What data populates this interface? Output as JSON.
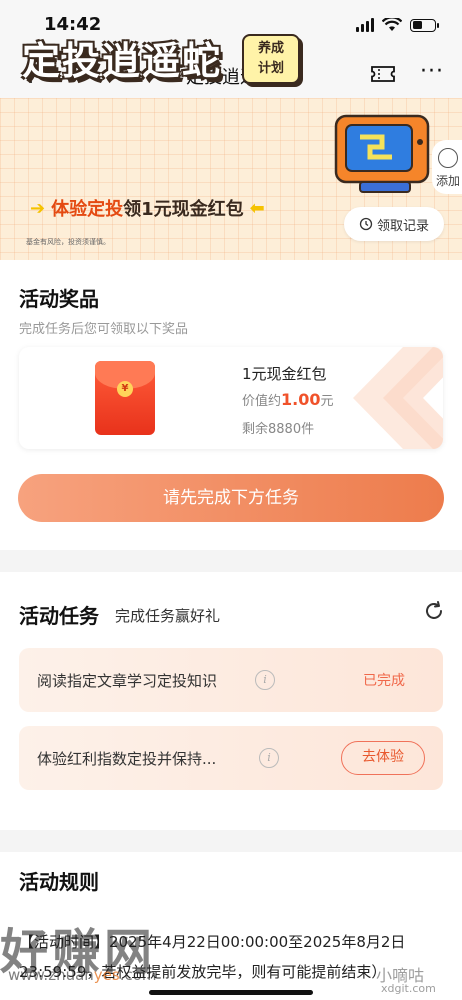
{
  "status_bar": {
    "time": "14:42"
  },
  "nav": {
    "title": "定投逍遥蛇",
    "more": "···"
  },
  "banner": {
    "title": "定投逍遥蛇",
    "badge_line1": "养成",
    "badge_line2": "计划",
    "subtitle_prefix": "体验定投",
    "subtitle_rest": "领1元现金红包",
    "risk_note": "基金有风险，投资须谨慎。",
    "add_favorite": "添加",
    "record_button": "领取记录"
  },
  "prize": {
    "section_title": "活动奖品",
    "section_sub": "完成任务后您可领取以下奖品",
    "coin_symbol": "¥",
    "name": "1元现金红包",
    "value_prefix": "价值约",
    "value_amount": "1.00",
    "value_unit": "元",
    "remaining": "剩余8880件",
    "cta": "请先完成下方任务"
  },
  "tasks": {
    "section_title": "活动任务",
    "section_sub": "完成任务赢好礼",
    "items": [
      {
        "label": "阅读指定文章学习定投知识",
        "status": "已完成"
      },
      {
        "label": "体验红利指数定投并保持...",
        "action": "去体验"
      }
    ]
  },
  "rules": {
    "section_title": "活动规则",
    "text": "【活动时间】2025年4月22日00:00:00至2025年8月2日23:59:59，若权益提前发放完毕，则有可能提前结束）"
  },
  "watermarks": {
    "big": "好赚网",
    "url_prefix": "www.zhuan",
    "url_highlight": "yes",
    "url_suffix": ".com",
    "right": "小嘀咕",
    "right_url": "xdgit.com"
  },
  "colors": {
    "accent": "#ed7c4c",
    "accent_text": "#f0522a",
    "banner_bg": "#fdeed8"
  }
}
